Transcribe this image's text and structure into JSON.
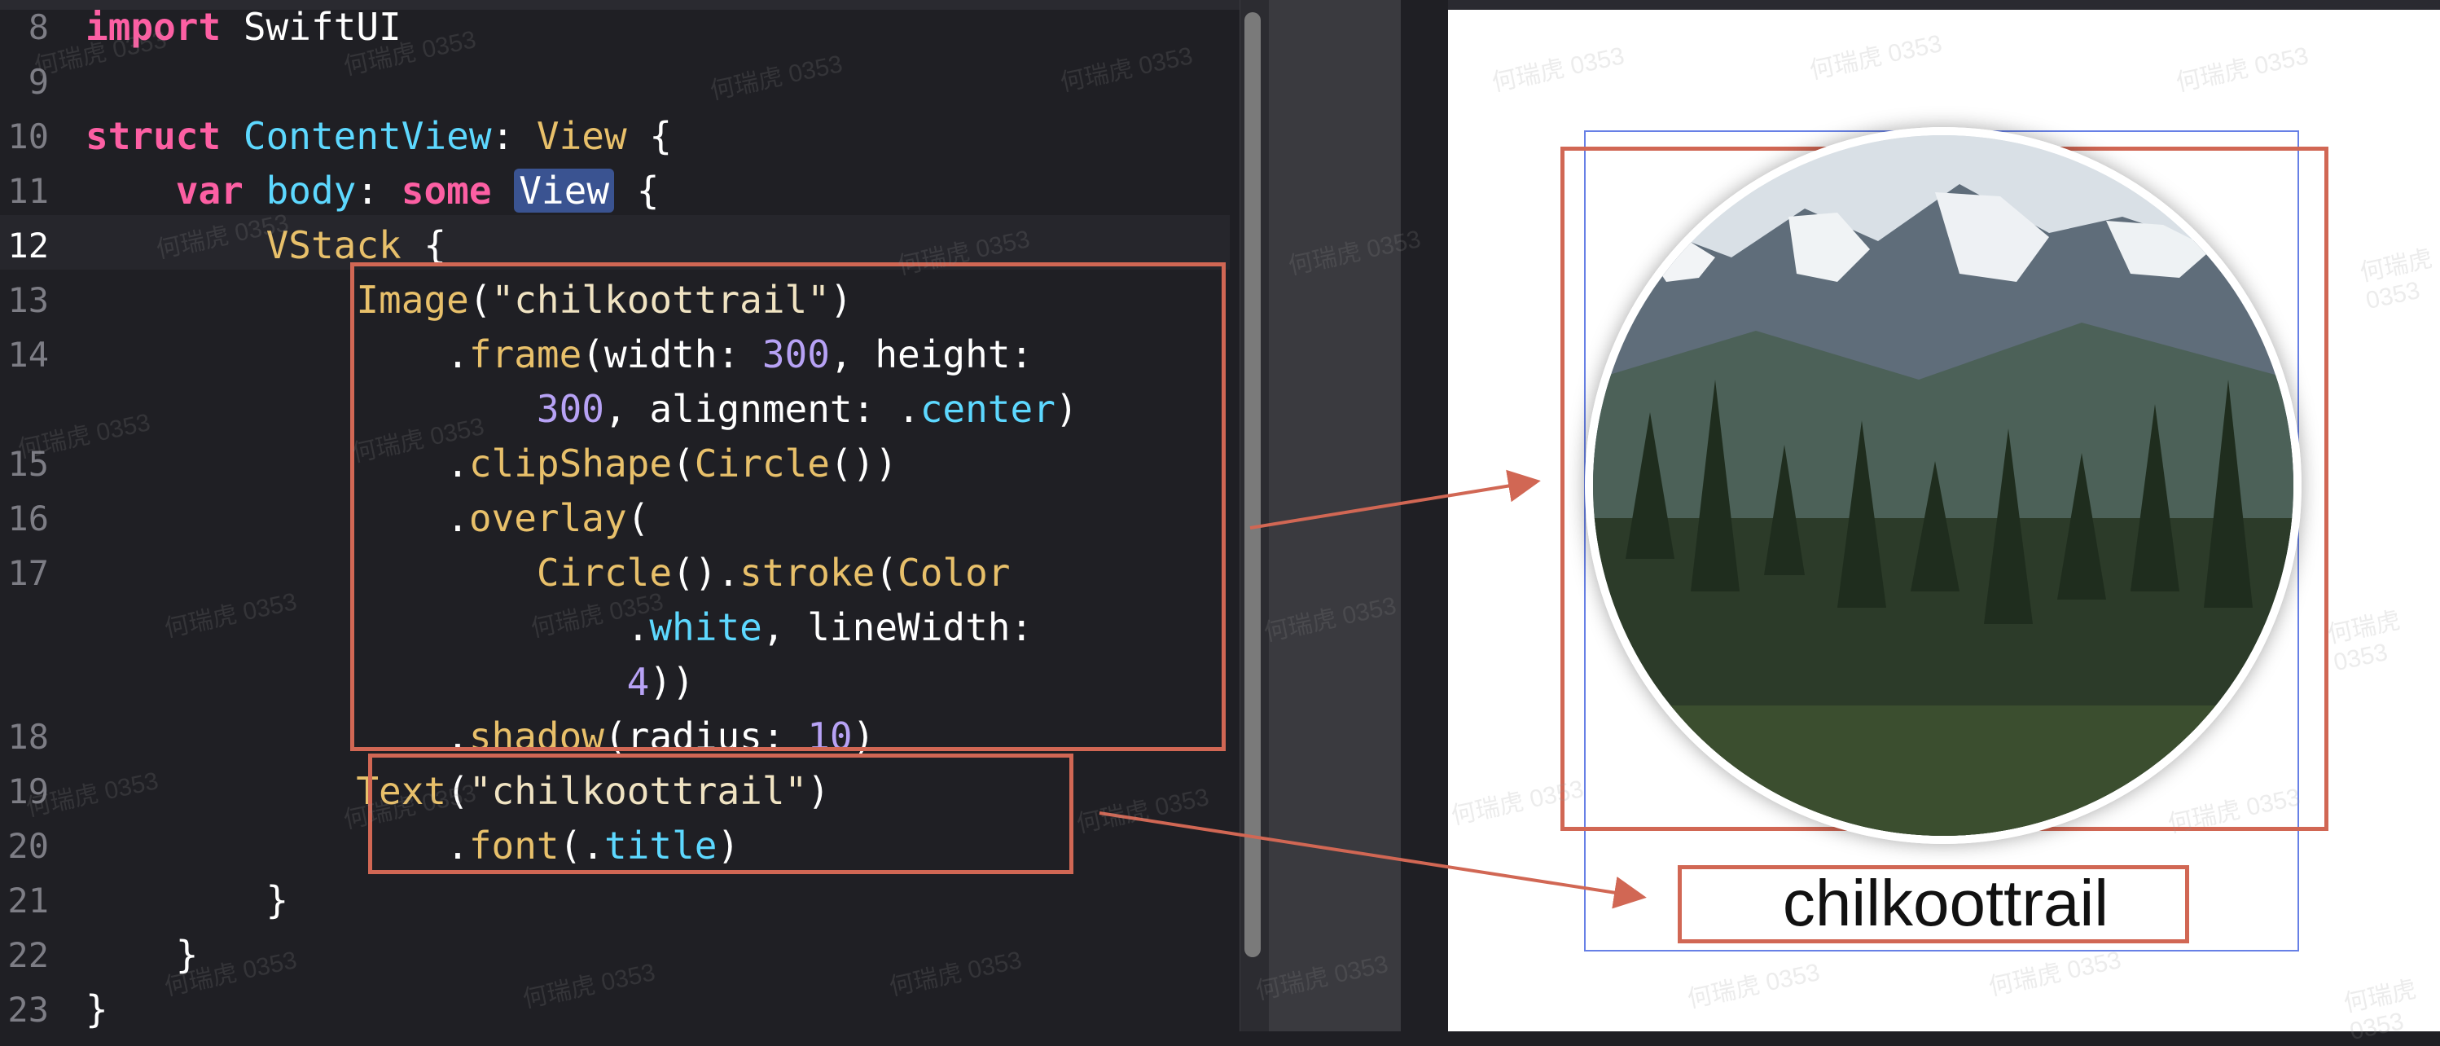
{
  "colors": {
    "editor_bg": "#1f1f24",
    "preview_bg": "#ffffff",
    "annotation": "#d16754",
    "layout_outline": "#6780e6",
    "keyword": "#fc5fa3",
    "type": "#5dd8ff",
    "number": "#b7a2f5"
  },
  "editor": {
    "lines": [
      {
        "number": "8",
        "text": "import SwiftUI"
      },
      {
        "number": "9",
        "text": ""
      },
      {
        "number": "10",
        "text": "struct ContentView: View {"
      },
      {
        "number": "11",
        "text": "    var body: some View {"
      },
      {
        "number": "12",
        "text": "        VStack {"
      },
      {
        "number": "13",
        "text": "            Image(\"chilkoottrail\")"
      },
      {
        "number": "14",
        "text": "                .frame(width: 300, height:"
      },
      {
        "number": "",
        "text": "                    300, alignment: .center)"
      },
      {
        "number": "15",
        "text": "                .clipShape(Circle())"
      },
      {
        "number": "16",
        "text": "                .overlay("
      },
      {
        "number": "17",
        "text": "                    Circle().stroke(Color"
      },
      {
        "number": "",
        "text": "                        .white, lineWidth:"
      },
      {
        "number": "",
        "text": "                        4))"
      },
      {
        "number": "18",
        "text": "                .shadow(radius: 10)"
      },
      {
        "number": "19",
        "text": "            Text(\"chilkoottrail\")"
      },
      {
        "number": "20",
        "text": "                .font(.title)"
      },
      {
        "number": "21",
        "text": "        }"
      },
      {
        "number": "22",
        "text": "    }"
      },
      {
        "number": "23",
        "text": "}"
      }
    ]
  },
  "preview": {
    "caption": "chilkoottrail",
    "image_name": "mountain-forest-photo"
  },
  "watermark_text": "何瑞虎 0353"
}
